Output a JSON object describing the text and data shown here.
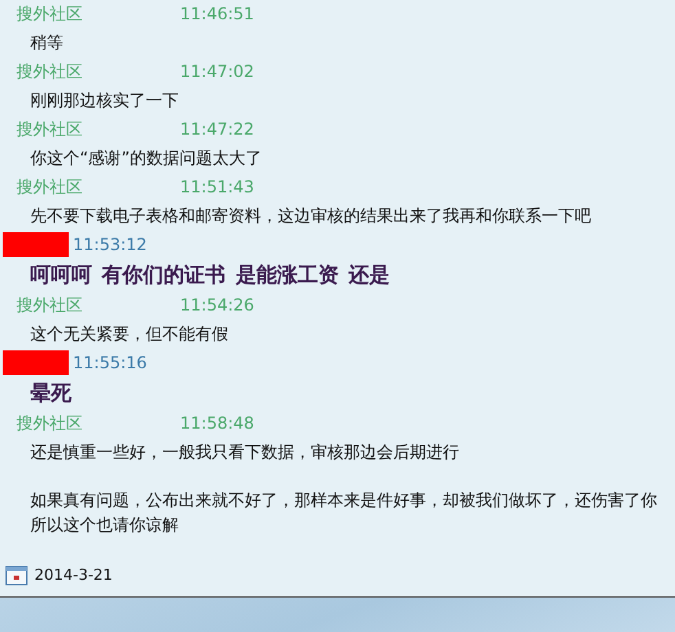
{
  "messages": [
    {
      "sender": {
        "kind": "named",
        "name": "搜外社区"
      },
      "time": "11:46:51",
      "emphasis": false,
      "paragraphs": [
        "稍等"
      ]
    },
    {
      "sender": {
        "kind": "named",
        "name": "搜外社区"
      },
      "time": "11:47:02",
      "emphasis": false,
      "paragraphs": [
        "刚刚那边核实了一下"
      ]
    },
    {
      "sender": {
        "kind": "named",
        "name": "搜外社区"
      },
      "time": "11:47:22",
      "emphasis": false,
      "paragraphs": [
        "你这个“感谢”的数据问题太大了"
      ]
    },
    {
      "sender": {
        "kind": "named",
        "name": "搜外社区"
      },
      "time": "11:51:43",
      "emphasis": false,
      "paragraphs": [
        "先不要下载电子表格和邮寄资料，这边审核的结果出来了我再和你联系一下吧"
      ]
    },
    {
      "sender": {
        "kind": "redacted"
      },
      "time": "11:53:12",
      "emphasis": true,
      "paragraphs": [
        "呵呵呵  有你们的证书  是能涨工资  还是"
      ]
    },
    {
      "sender": {
        "kind": "named",
        "name": "搜外社区"
      },
      "time": "11:54:26",
      "emphasis": false,
      "paragraphs": [
        "这个无关紧要，但不能有假"
      ]
    },
    {
      "sender": {
        "kind": "redacted"
      },
      "time": "11:55:16",
      "emphasis": true,
      "paragraphs": [
        "晕死"
      ]
    },
    {
      "sender": {
        "kind": "named",
        "name": "搜外社区"
      },
      "time": "11:58:48",
      "emphasis": false,
      "paragraphs": [
        "还是慎重一些好，一般我只看下数据，审核那边会后期进行",
        "如果真有问题，公布出来就不好了，那样本来是件好事，却被我们做坏了，还伤害了你所以这个也请你谅解"
      ]
    }
  ],
  "date_bar": {
    "date": "2014-3-21"
  }
}
